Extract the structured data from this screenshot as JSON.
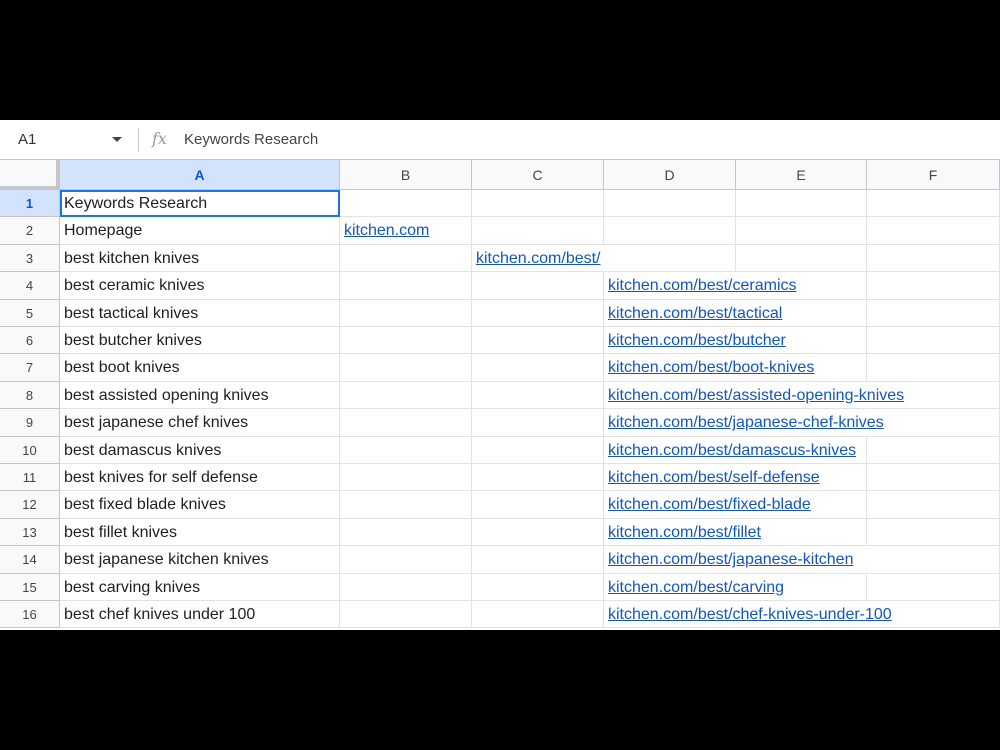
{
  "formula_bar": {
    "cell_ref": "A1",
    "content": "Keywords Research"
  },
  "columns": [
    "A",
    "B",
    "C",
    "D",
    "E",
    "F"
  ],
  "rows": [
    {
      "num": "1",
      "a": "Keywords Research",
      "b": "",
      "c": "",
      "d": ""
    },
    {
      "num": "2",
      "a": "Homepage",
      "b": "kitchen.com",
      "c": "",
      "d": ""
    },
    {
      "num": "3",
      "a": "best kitchen knives",
      "b": "",
      "c": "kitchen.com/best/",
      "d": ""
    },
    {
      "num": "4",
      "a": "best ceramic knives",
      "b": "",
      "c": "",
      "d": "kitchen.com/best/ceramics"
    },
    {
      "num": "5",
      "a": "best tactical knives",
      "b": "",
      "c": "",
      "d": "kitchen.com/best/tactical"
    },
    {
      "num": "6",
      "a": "best butcher knives",
      "b": "",
      "c": "",
      "d": "kitchen.com/best/butcher"
    },
    {
      "num": "7",
      "a": "best boot knives",
      "b": "",
      "c": "",
      "d": "kitchen.com/best/boot-knives"
    },
    {
      "num": "8",
      "a": "best assisted opening knives",
      "b": "",
      "c": "",
      "d": "kitchen.com/best/assisted-opening-knives"
    },
    {
      "num": "9",
      "a": "best japanese chef knives",
      "b": "",
      "c": "",
      "d": "kitchen.com/best/japanese-chef-knives"
    },
    {
      "num": "10",
      "a": "best damascus knives",
      "b": "",
      "c": "",
      "d": "kitchen.com/best/damascus-knives"
    },
    {
      "num": "11",
      "a": "best knives for self defense",
      "b": "",
      "c": "",
      "d": "kitchen.com/best/self-defense"
    },
    {
      "num": "12",
      "a": "best fixed blade knives",
      "b": "",
      "c": "",
      "d": "kitchen.com/best/fixed-blade"
    },
    {
      "num": "13",
      "a": "best fillet knives",
      "b": "",
      "c": "",
      "d": "kitchen.com/best/fillet"
    },
    {
      "num": "14",
      "a": "best japanese kitchen knives",
      "b": "",
      "c": "",
      "d": "kitchen.com/best/japanese-kitchen"
    },
    {
      "num": "15",
      "a": "best carving knives",
      "b": "",
      "c": "",
      "d": "kitchen.com/best/carving"
    },
    {
      "num": "16",
      "a": "best chef knives under 100",
      "b": "",
      "c": "",
      "d": "kitchen.com/best/chef-knives-under-100"
    }
  ],
  "colors": {
    "link": "#1155cc",
    "selection": "#1a73e8",
    "header_selected": "#d3e3fd"
  }
}
